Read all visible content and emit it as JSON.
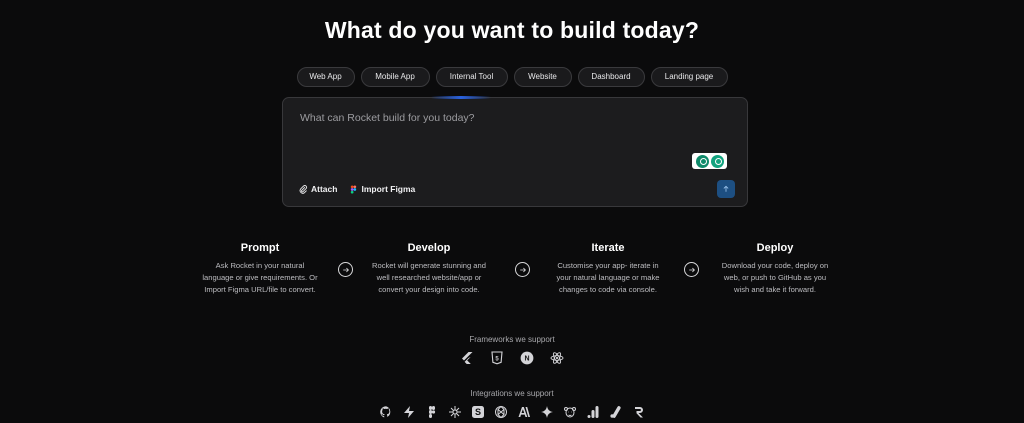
{
  "page": {
    "title": "What do you want to build today?"
  },
  "chips": [
    "Web App",
    "Mobile App",
    "Internal Tool",
    "Website",
    "Dashboard",
    "Landing page"
  ],
  "prompt": {
    "placeholder": "What can Rocket build for you today?",
    "attach_label": "Attach",
    "import_figma_label": "Import Figma"
  },
  "steps": [
    {
      "title": "Prompt",
      "lines": [
        "Ask Rocket in your natural",
        "language or give requirements. Or",
        "Import Figma URL/file to convert."
      ]
    },
    {
      "title": "Develop",
      "lines": [
        "Rocket will generate stunning and",
        "well researched website/app or",
        "convert your design into code."
      ]
    },
    {
      "title": "Iterate",
      "lines": [
        "Customise your app- iterate in",
        "your natural language or make",
        "changes to code via console."
      ]
    },
    {
      "title": "Deploy",
      "lines": [
        "Download your code, deploy on",
        "web, or push to GitHub as you",
        "wish and take it forward."
      ]
    }
  ],
  "frameworks": {
    "label": "Frameworks we support",
    "icons": [
      "flutter-icon",
      "html5-icon",
      "nextjs-icon",
      "react-icon"
    ]
  },
  "integrations": {
    "label": "Integrations we support",
    "icons": [
      "github-icon",
      "supabase-icon",
      "figma-icon",
      "perplexity-icon",
      "stripe-icon",
      "openai-icon",
      "anthropic-icon",
      "gemini-icon",
      "mailchimp-icon",
      "google-analytics-icon",
      "adsense-icon",
      "resend-icon"
    ]
  },
  "colors": {
    "background": "#0b0b0c",
    "send_button": "#1d4f82",
    "accent_glow": "#2a62e0"
  }
}
